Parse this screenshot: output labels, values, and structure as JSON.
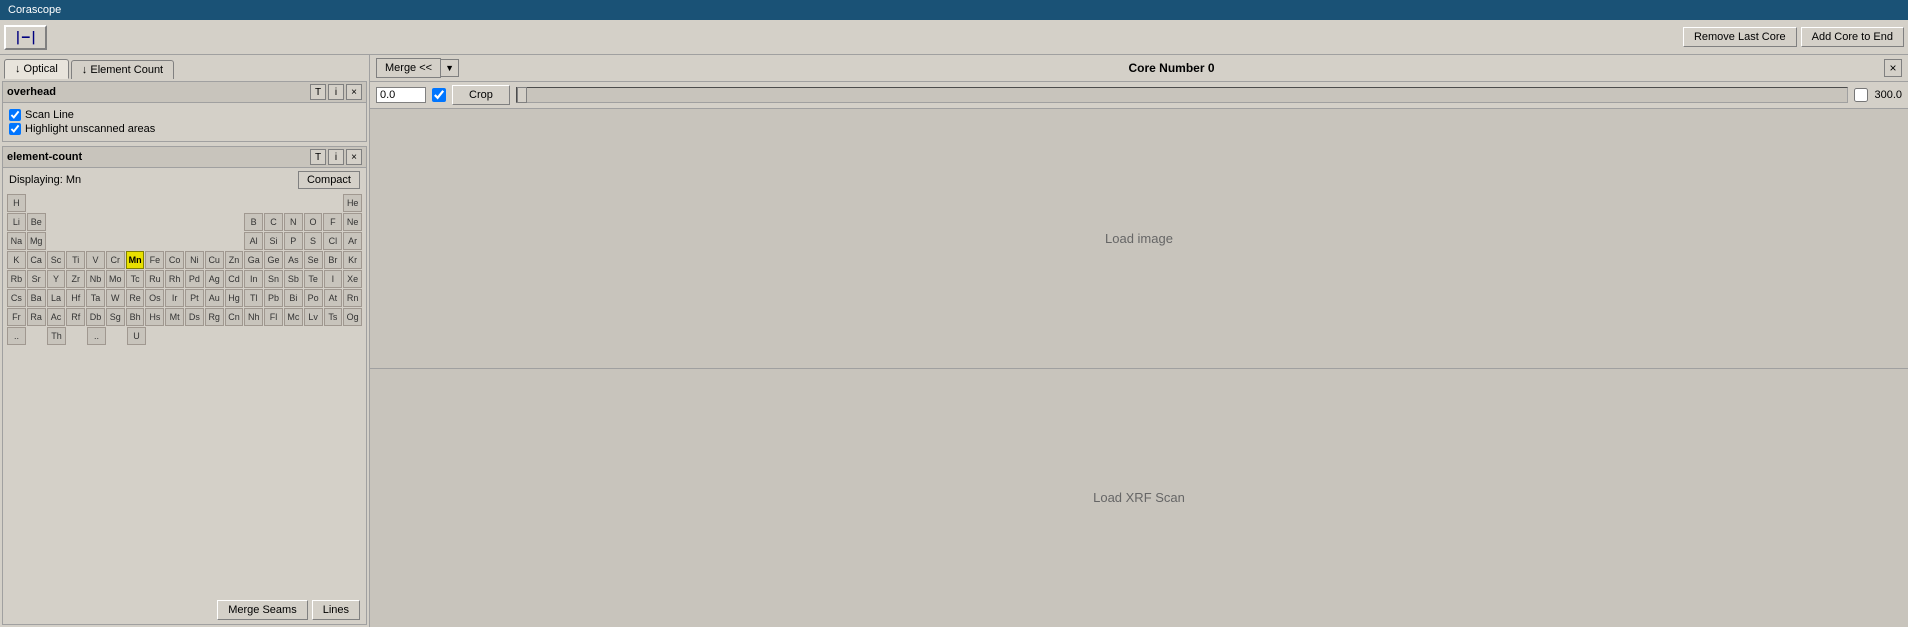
{
  "app": {
    "title": "Corascope"
  },
  "toolbar": {
    "ruler_icon": "|—|",
    "remove_last_core": "Remove Last Core",
    "add_core_to_end": "Add Core to End"
  },
  "tabs": [
    {
      "id": "optical",
      "label": "↓ Optical"
    },
    {
      "id": "element-count",
      "label": "↓ Element Count"
    }
  ],
  "overhead_panel": {
    "title": "overhead",
    "scan_line_label": "Scan Line",
    "scan_line_checked": true,
    "highlight_label": "Highlight unscanned areas",
    "highlight_checked": true
  },
  "element_count_panel": {
    "title": "element-count",
    "displaying_label": "Displaying: Mn",
    "compact_btn": "Compact"
  },
  "periodic_table": {
    "rows": [
      [
        "H",
        "",
        "",
        "",
        "",
        "",
        "",
        "",
        "",
        "",
        "",
        "",
        "",
        "",
        "",
        "",
        "",
        "He"
      ],
      [
        "Li",
        "Be",
        "",
        "",
        "",
        "",
        "",
        "",
        "",
        "",
        "",
        "",
        "B",
        "C",
        "N",
        "O",
        "F",
        "Ne"
      ],
      [
        "Na",
        "Mg",
        "",
        "",
        "",
        "",
        "",
        "",
        "",
        "",
        "",
        "",
        "Al",
        "Si",
        "P",
        "S",
        "Cl",
        "Ar"
      ],
      [
        "K",
        "Ca",
        "Sc",
        "Ti",
        "V",
        "Cr",
        "Mn",
        "Fe",
        "Co",
        "Ni",
        "Cu",
        "Zn",
        "Ga",
        "Ge",
        "As",
        "Se",
        "Br",
        "Kr"
      ],
      [
        "Rb",
        "Sr",
        "Y",
        "Zr",
        "Nb",
        "Mo",
        "Tc",
        "Ru",
        "Rh",
        "Pd",
        "Ag",
        "Cd",
        "In",
        "Sn",
        "Sb",
        "Te",
        "I",
        "Xe"
      ],
      [
        "Cs",
        "Ba",
        "La",
        "Hf",
        "Ta",
        "W",
        "Re",
        "Os",
        "Ir",
        "Pt",
        "Au",
        "Hg",
        "Tl",
        "Pb",
        "Bi",
        "Po",
        "At",
        "Rn"
      ],
      [
        "Fr",
        "Ra",
        "Ac",
        "Rf",
        "Db",
        "Sg",
        "Bh",
        "Hs",
        "Mt",
        "Ds",
        "Rg",
        "Cn",
        "Nh",
        "Fl",
        "Mc",
        "Lv",
        "Ts",
        "Og"
      ],
      [
        "..",
        "",
        "Th",
        "",
        "..",
        "",
        "U",
        "",
        "",
        "",
        "",
        "",
        "",
        "",
        "",
        "",
        "",
        ""
      ]
    ],
    "selected": "Mn"
  },
  "bottom_btns": {
    "merge_seams": "Merge Seams",
    "lines": "Lines"
  },
  "core_viewer": {
    "merge_btn": "Merge <<",
    "core_number": "Core Number 0",
    "close_btn": "×",
    "start_val": "0.0",
    "crop_btn": "Crop",
    "end_val": "300.0",
    "load_image": "Load image",
    "load_xrf": "Load XRF Scan"
  }
}
